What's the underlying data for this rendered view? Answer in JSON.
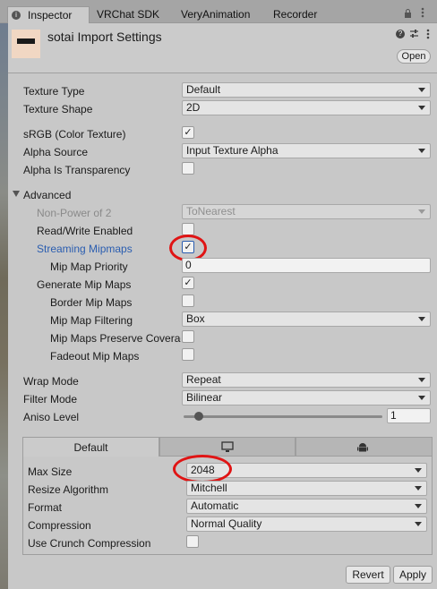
{
  "tabs": [
    {
      "label": "Inspector",
      "icon": "info-icon"
    },
    {
      "label": "VRChat SDK"
    },
    {
      "label": "VeryAnimation"
    },
    {
      "label": "Recorder"
    }
  ],
  "header": {
    "title": "sotai Import Settings",
    "open_label": "Open"
  },
  "texture_type": {
    "label": "Texture Type",
    "value": "Default"
  },
  "texture_shape": {
    "label": "Texture Shape",
    "value": "2D"
  },
  "srgb": {
    "label": "sRGB (Color Texture)",
    "checked": true
  },
  "alpha_source": {
    "label": "Alpha Source",
    "value": "Input Texture Alpha"
  },
  "alpha_transparency": {
    "label": "Alpha Is Transparency",
    "checked": false
  },
  "advanced": {
    "label": "Advanced",
    "npot": {
      "label": "Non-Power of 2",
      "value": "ToNearest"
    },
    "readwrite": {
      "label": "Read/Write Enabled",
      "checked": false
    },
    "streaming": {
      "label": "Streaming Mipmaps",
      "checked": true
    },
    "mip_priority": {
      "label": "Mip Map Priority",
      "value": "0"
    },
    "gen_mips": {
      "label": "Generate Mip Maps",
      "checked": true
    },
    "border_mips": {
      "label": "Border Mip Maps",
      "checked": false
    },
    "mip_filter": {
      "label": "Mip Map Filtering",
      "value": "Box"
    },
    "preserve_cov": {
      "label": "Mip Maps Preserve Coverage",
      "checked": false
    },
    "fadeout": {
      "label": "Fadeout Mip Maps",
      "checked": false
    }
  },
  "wrap_mode": {
    "label": "Wrap Mode",
    "value": "Repeat"
  },
  "filter_mode": {
    "label": "Filter Mode",
    "value": "Bilinear"
  },
  "aniso": {
    "label": "Aniso Level",
    "value": "1",
    "slider_fraction": 0.0
  },
  "platform": {
    "tabs": [
      {
        "label": "Default",
        "icon": null
      },
      {
        "label": "",
        "icon": "monitor-icon"
      },
      {
        "label": "",
        "icon": "android-icon"
      }
    ],
    "max_size": {
      "label": "Max Size",
      "value": "2048"
    },
    "resize": {
      "label": "Resize Algorithm",
      "value": "Mitchell"
    },
    "format": {
      "label": "Format",
      "value": "Automatic"
    },
    "compression": {
      "label": "Compression",
      "value": "Normal Quality"
    },
    "crunch": {
      "label": "Use Crunch Compression",
      "checked": false
    }
  },
  "footer": {
    "revert_label": "Revert",
    "apply_label": "Apply"
  },
  "colors": {
    "highlight_ring": "#e01414",
    "link_blue": "#2a5db0"
  }
}
